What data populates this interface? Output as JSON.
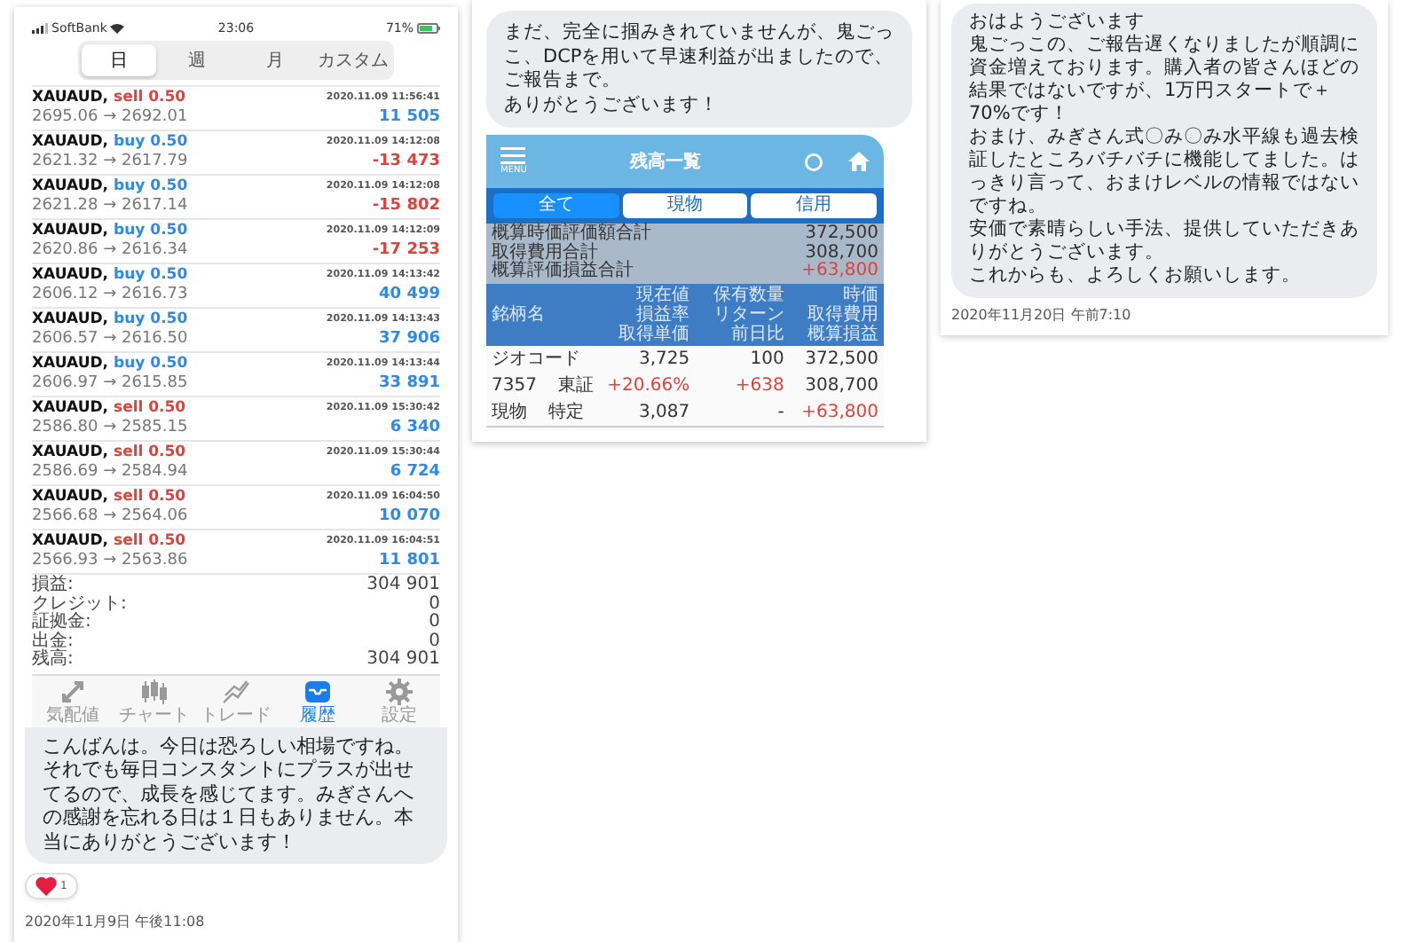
{
  "trade_post": {
    "status_bar": {
      "carrier": "SoftBank",
      "time": "23:06",
      "battery": "71%"
    },
    "period_tabs": [
      {
        "label": "日",
        "selected": true
      },
      {
        "label": "週",
        "selected": false
      },
      {
        "label": "月",
        "selected": false
      },
      {
        "label": "カスタム",
        "selected": false
      }
    ],
    "trades": [
      {
        "symbol": "XAUAUD,",
        "order": "sell 0.50",
        "kind": "sell",
        "time": "2020.11.09 11:56:41",
        "prices": "2695.06 → 2692.01",
        "profit": "11 505",
        "loss": false
      },
      {
        "symbol": "XAUAUD,",
        "order": "buy 0.50",
        "kind": "buy",
        "time": "2020.11.09 14:12:08",
        "prices": "2621.32 → 2617.79",
        "profit": "-13 473",
        "loss": true
      },
      {
        "symbol": "XAUAUD,",
        "order": "buy 0.50",
        "kind": "buy",
        "time": "2020.11.09 14:12:08",
        "prices": "2621.28 → 2617.14",
        "profit": "-15 802",
        "loss": true
      },
      {
        "symbol": "XAUAUD,",
        "order": "buy 0.50",
        "kind": "buy",
        "time": "2020.11.09 14:12:09",
        "prices": "2620.86 → 2616.34",
        "profit": "-17 253",
        "loss": true
      },
      {
        "symbol": "XAUAUD,",
        "order": "buy 0.50",
        "kind": "buy",
        "time": "2020.11.09 14:13:42",
        "prices": "2606.12 → 2616.73",
        "profit": "40 499",
        "loss": false
      },
      {
        "symbol": "XAUAUD,",
        "order": "buy 0.50",
        "kind": "buy",
        "time": "2020.11.09 14:13:43",
        "prices": "2606.57 → 2616.50",
        "profit": "37 906",
        "loss": false
      },
      {
        "symbol": "XAUAUD,",
        "order": "buy 0.50",
        "kind": "buy",
        "time": "2020.11.09 14:13:44",
        "prices": "2606.97 → 2615.85",
        "profit": "33 891",
        "loss": false
      },
      {
        "symbol": "XAUAUD,",
        "order": "sell 0.50",
        "kind": "sell",
        "time": "2020.11.09 15:30:42",
        "prices": "2586.80 → 2585.15",
        "profit": "6 340",
        "loss": false
      },
      {
        "symbol": "XAUAUD,",
        "order": "sell 0.50",
        "kind": "sell",
        "time": "2020.11.09 15:30:44",
        "prices": "2586.69 → 2584.94",
        "profit": "6 724",
        "loss": false
      },
      {
        "symbol": "XAUAUD,",
        "order": "sell 0.50",
        "kind": "sell",
        "time": "2020.11.09 16:04:50",
        "prices": "2566.68 → 2564.06",
        "profit": "10 070",
        "loss": false
      },
      {
        "symbol": "XAUAUD,",
        "order": "sell 0.50",
        "kind": "sell",
        "time": "2020.11.09 16:04:51",
        "prices": "2566.93 → 2563.86",
        "profit": "11 801",
        "loss": false
      }
    ],
    "summary": [
      {
        "label": "損益:",
        "value": "304 901"
      },
      {
        "label": "クレジット:",
        "value": "0"
      },
      {
        "label": "証拠金:",
        "value": "0"
      },
      {
        "label": "出金:",
        "value": "0"
      },
      {
        "label": "残高:",
        "value": "304 901"
      }
    ],
    "bottom_nav": [
      {
        "label": "気配値",
        "kind": "quotes",
        "selected": false
      },
      {
        "label": "チャート",
        "kind": "chart",
        "selected": false
      },
      {
        "label": "トレード",
        "kind": "trade",
        "selected": false
      },
      {
        "label": "履歴",
        "kind": "history",
        "selected": true
      },
      {
        "label": "設定",
        "kind": "settings",
        "selected": false
      }
    ],
    "message": "こんばんは。今日は恐ろしい相場ですね。それでも毎日コンスタントにプラスが出せてるので、成長を感じてます。みぎさんへの感謝を忘れる日は１日もありません。本当にありがとうございます！",
    "reaction": {
      "count": "1"
    },
    "timestamp": "2020年11月9日 午後11:08"
  },
  "balance_post": {
    "message": [
      "まだ、完全に掴みきれていませんが、鬼ごっこ、DCPを用いて早速利益が出ましたので、",
      "ご報告まで。",
      "ありがとうございます！"
    ],
    "header": {
      "menu_label": "MENU",
      "title": "残高一覧"
    },
    "tabs": [
      {
        "label": "全て",
        "selected": true
      },
      {
        "label": "現物",
        "selected": false
      },
      {
        "label": "信用",
        "selected": false
      }
    ],
    "totals": [
      {
        "label": "概算時価評価額合計",
        "value": "372,500",
        "gain": false
      },
      {
        "label": "取得費用合計",
        "value": "308,700",
        "gain": false
      },
      {
        "label": "概算評価損益合計",
        "value": "+63,800",
        "gain": true
      }
    ],
    "columns": [
      [
        "銘柄名"
      ],
      [
        "現在値",
        "損益率",
        "取得単価"
      ],
      [
        "保有数量",
        "リターン",
        "前日比"
      ],
      [
        "時価",
        "取得費用",
        "概算損益"
      ]
    ],
    "rows": [
      {
        "name": [
          "ジオコード"
        ],
        "values": [
          {
            "text": "3,725",
            "gain": false
          },
          {
            "text": "100",
            "gain": false
          },
          {
            "text": "372,500",
            "gain": false
          }
        ]
      },
      {
        "name": [
          "7357",
          "東証"
        ],
        "values": [
          {
            "text": "+20.66%",
            "gain": true
          },
          {
            "text": "+638",
            "gain": true
          },
          {
            "text": "308,700",
            "gain": false
          }
        ]
      },
      {
        "name": [
          "現物",
          "特定"
        ],
        "values": [
          {
            "text": "3,087",
            "gain": false
          },
          {
            "text": "-",
            "gain": false
          },
          {
            "text": "+63,800",
            "gain": true
          }
        ]
      }
    ]
  },
  "report_post": {
    "message": [
      "おはようございます",
      "鬼ごっこの、ご報告遅くなりましたが順調に資金増えております。購入者の皆さんほどの結果ではないですが、1万円スタートで＋70%です！",
      "おまけ、みぎさん式〇み〇み水平線も過去検証したところバチバチに機能してました。はっきり言って、おまけレベルの情報ではないですね。",
      "安価で素晴らしい手法、提供していただきありがとうございます。",
      "これからも、よろしくお願いします。"
    ],
    "timestamp": "2020年11月20日 午前7:10"
  }
}
